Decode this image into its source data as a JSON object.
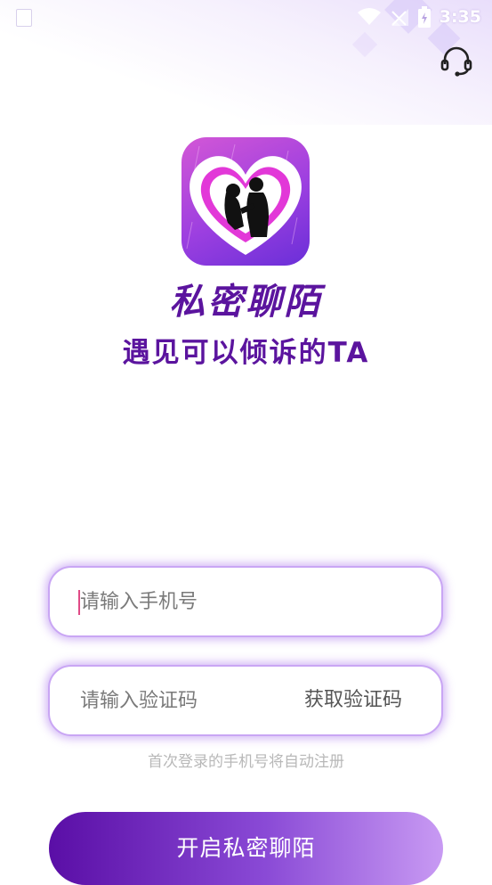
{
  "status_bar": {
    "time": "3:35",
    "icons": [
      "notification-icon",
      "wifi-icon",
      "signal-icon",
      "battery-icon"
    ]
  },
  "header": {
    "support_icon": "headset-icon"
  },
  "branding": {
    "app_name": "私密聊陌",
    "slogan": "遇见可以倾诉的TA",
    "logo_icon": "couple-heart-logo"
  },
  "login_form": {
    "phone_placeholder": "请输入手机号",
    "phone_value": "",
    "code_placeholder": "请输入验证码",
    "code_value": "",
    "get_code_label": "获取验证码",
    "hint": "首次登录的手机号将自动注册",
    "submit_label": "开启私密聊陌"
  },
  "colors": {
    "brand_purple": "#5b149e",
    "field_glow": "#a064eb",
    "button_gradient_start": "#5a0ea6",
    "button_gradient_end": "#c89af3",
    "caret": "#e04a86"
  }
}
